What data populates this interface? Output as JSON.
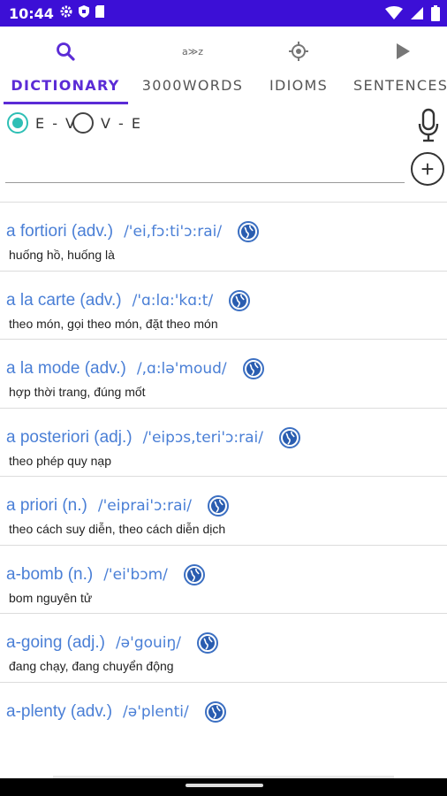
{
  "status_bar": {
    "time": "10:44"
  },
  "tabs": [
    {
      "label": "DICTIONARY",
      "icon": "search-icon",
      "active": true
    },
    {
      "label": "3000WORDS",
      "icon": "a-z-icon",
      "active": false
    },
    {
      "label": "IDIOMS",
      "icon": "target-icon",
      "active": false
    },
    {
      "label": "SENTENCES",
      "icon": "play-icon",
      "active": false
    }
  ],
  "tab_icons": {
    "az_text": "a≫z"
  },
  "mode": {
    "options": [
      "E - V",
      "V - E"
    ],
    "selected": "E - V"
  },
  "search": {
    "value": "",
    "placeholder": ""
  },
  "add_button": "+",
  "entries": [
    {
      "word": "a fortiori (adv.)",
      "phonetic": "/'ei,fɔ:ti'ɔ:rai/",
      "meaning": "huống hồ, huống là"
    },
    {
      "word": "a la carte (adv.)",
      "phonetic": "/'ɑ:lɑ:'kɑ:t/",
      "meaning": "theo món, gọi theo món, đặt theo món"
    },
    {
      "word": "a la mode (adv.)",
      "phonetic": "/,ɑ:lə'moud/",
      "meaning": "hợp thời trang, đúng mốt"
    },
    {
      "word": "a posteriori (adj.)",
      "phonetic": "/'eipɔs,teri'ɔ:rai/",
      "meaning": "theo phép quy nạp"
    },
    {
      "word": "a priori (n.)",
      "phonetic": "/'eiprai'ɔ:rai/",
      "meaning": "theo cách suy diễn, theo cách diễn dịch"
    },
    {
      "word": "a-bomb (n.)",
      "phonetic": "/'ei'bɔm/",
      "meaning": "bom nguyên tử"
    },
    {
      "word": "a-going (adj.)",
      "phonetic": "/ə'gouiŋ/",
      "meaning": "đang chạy, đang chuyển động"
    },
    {
      "word": "a-plenty (adv.)",
      "phonetic": "/ə'plenti/",
      "meaning": ""
    }
  ],
  "colors": {
    "status_bar": "#3c0fd6",
    "accent": "#5b2bd6",
    "word": "#4a7fd6",
    "radio": "#2ebfb5"
  }
}
